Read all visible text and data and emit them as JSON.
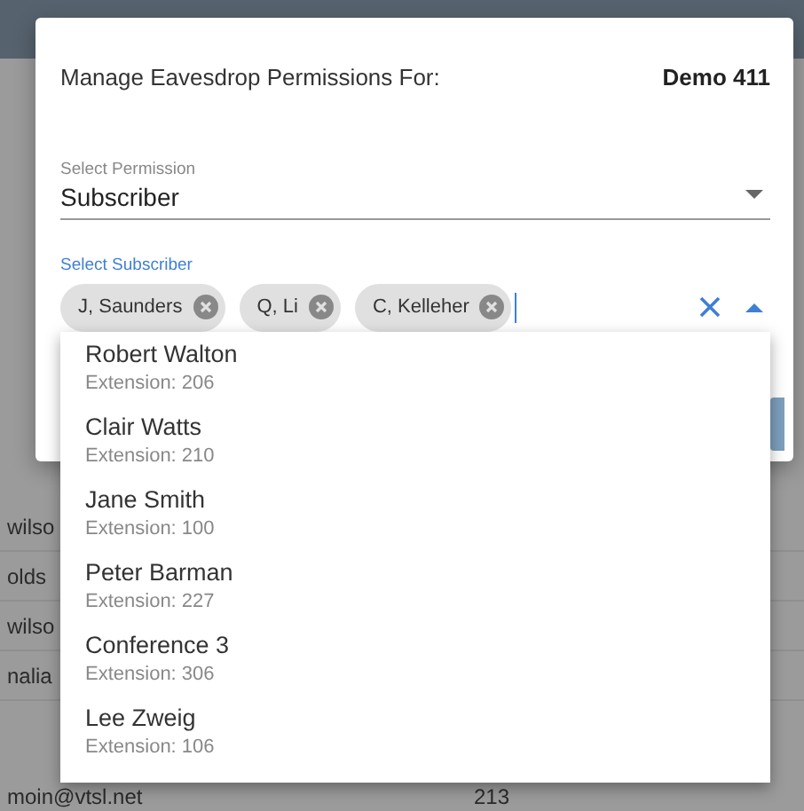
{
  "background_table": {
    "rows": [
      {
        "cells": [
          "wilso"
        ]
      },
      {
        "cells": [
          "olds"
        ]
      },
      {
        "cells": [
          "wilso"
        ]
      },
      {
        "cells": [
          "nalia"
        ]
      },
      {
        "cells": [
          "moin@vtsl.net",
          "213"
        ]
      }
    ]
  },
  "dialog": {
    "title": "Manage Eavesdrop Permissions For:",
    "subject": "Demo 411",
    "permission_select": {
      "label": "Select Permission",
      "value": "Subscriber"
    },
    "subscriber_select": {
      "label": "Select Subscriber",
      "focused": true,
      "expanded": true,
      "chips": [
        {
          "label": "J, Saunders"
        },
        {
          "label": "Q, Li"
        },
        {
          "label": "C, Kelleher"
        }
      ],
      "options": [
        {
          "name": "Robert Walton",
          "detail": "Extension: 206"
        },
        {
          "name": "Clair Watts",
          "detail": "Extension: 210"
        },
        {
          "name": "Jane Smith",
          "detail": "Extension: 100"
        },
        {
          "name": "Peter Barman",
          "detail": "Extension: 227"
        },
        {
          "name": "Conference 3",
          "detail": "Extension: 306"
        },
        {
          "name": "Lee Zweig",
          "detail": "Extension: 106"
        }
      ]
    }
  }
}
